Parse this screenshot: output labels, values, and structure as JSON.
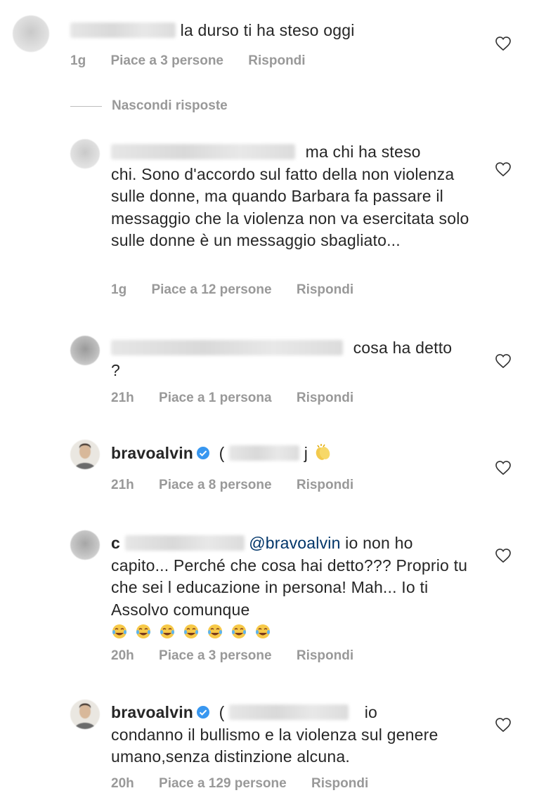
{
  "comments": [
    {
      "text": "la durso ti ha steso oggi",
      "time": "1g",
      "likes": "Piace a 3 persone",
      "reply": "Rispondi"
    },
    {
      "line1": "ma chi ha steso",
      "rest": "chi. Sono d'accordo sul fatto della non violenza sulle donne, ma quando Barbara fa passare il messaggio che la violenza non va esercitata solo sulle donne è un messaggio sbagliato...",
      "time": "1g",
      "likes": "Piace a 12 persone",
      "reply": "Rispondi"
    },
    {
      "line1": "cosa ha detto",
      "rest": "?",
      "time": "21h",
      "likes": "Piace a 1 persona",
      "reply": "Rispondi"
    },
    {
      "username": "bravoalvin",
      "text_prefix": "(",
      "text_suffix": "j",
      "time": "21h",
      "likes": "Piace a 8 persone",
      "reply": "Rispondi"
    },
    {
      "user_initial": "c",
      "mention": "@bravoalvin",
      "line1": "io non ho",
      "rest": "capito... Perché che cosa hai detto??? Proprio tu che sei l educazione in persona! Mah... Io ti Assolvo comunque",
      "time": "20h",
      "likes": "Piace a 3 persone",
      "reply": "Rispondi"
    },
    {
      "username": "bravoalvin",
      "text_prefix": "(",
      "line1": "io",
      "rest": "condanno il bullismo e la violenza sul genere umano,senza distinzione alcuna.",
      "time": "20h",
      "likes": "Piace a 129 persone",
      "reply": "Rispondi"
    }
  ],
  "hide_replies": "Nascondi risposte",
  "icons": {
    "heart": "heart-outline-icon",
    "verified": "verified-badge-icon",
    "clap": "clapping-hands-emoji",
    "laugh": "tears-of-joy-emoji"
  },
  "colors": {
    "text": "#262626",
    "meta": "#999999",
    "verified": "#3897f0"
  }
}
